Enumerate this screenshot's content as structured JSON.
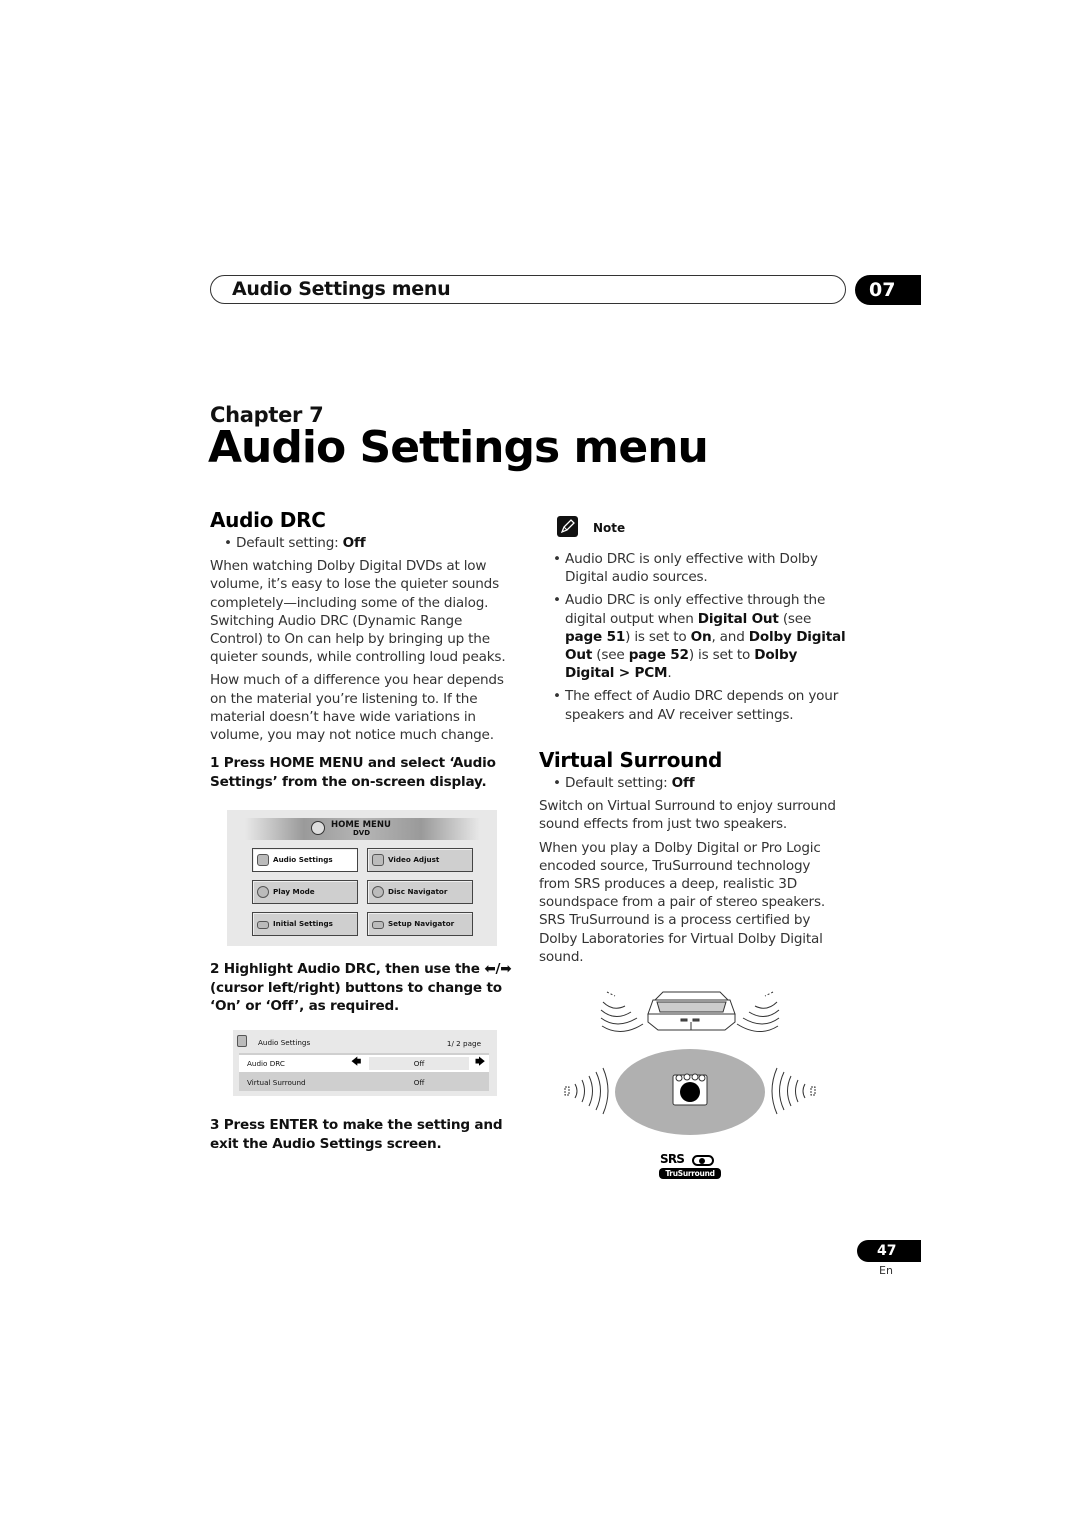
{
  "header": {
    "section_title": "Audio Settings menu",
    "chapter_number": "07"
  },
  "chapter": {
    "label": "Chapter 7",
    "title": "Audio Settings menu"
  },
  "audio_drc": {
    "heading": "Audio DRC",
    "default_label": "Default setting: ",
    "default_value": "Off",
    "paragraphs": [
      "When watching Dolby Digital DVDs at low volume, it’s easy to lose the quieter sounds completely—including some of the dialog. Switching Audio DRC (Dynamic Range Control) to On can help by bringing up the quieter sounds, while controlling loud peaks.",
      "How much of a difference you hear depends on the material you’re listening to. If the material doesn’t have wide variations in volume, you may not notice much change."
    ],
    "steps": [
      "1   Press HOME MENU and select ‘Audio Settings’ from the on-screen display.",
      "2   Highlight Audio DRC, then use the ⬅/➡ (cursor left/right) buttons to change to ‘On’ or ‘Off’, as required.",
      "3   Press ENTER to make the setting and exit the Audio Settings screen."
    ]
  },
  "home_menu_screen": {
    "title": "HOME MENU",
    "subtitle": "DVD",
    "title_icon": "disc-icon",
    "buttons": [
      {
        "label": "Audio Settings",
        "icon": "speaker-icon",
        "selected": true
      },
      {
        "label": "Video Adjust",
        "icon": "monitor-icon",
        "selected": false
      },
      {
        "label": "Play Mode",
        "icon": "play-mode-icon",
        "selected": false
      },
      {
        "label": "Disc Navigator",
        "icon": "disc-navigator-icon",
        "selected": false
      },
      {
        "label": "Initial Settings",
        "icon": "settings-icon",
        "selected": false
      },
      {
        "label": "Setup Navigator",
        "icon": "setup-navigator-icon",
        "selected": false
      }
    ]
  },
  "audio_settings_screen": {
    "title": "Audio Settings",
    "page_indicator": "1/  2 page",
    "rows": [
      {
        "name": "Audio DRC",
        "value": "Off",
        "selected": true
      },
      {
        "name": "Virtual Surround",
        "value": "Off",
        "selected": false
      }
    ],
    "left_arrow": "🡄",
    "right_arrow": "🡆"
  },
  "note": {
    "label": "Note",
    "icon": "pencil-icon",
    "items": [
      "Audio DRC is only effective with Dolby Digital audio sources.",
      "Audio DRC is only effective through the digital output when <b>Digital Out</b> (see <b>page 51</b>) is set to <b>On</b>, and <b>Dolby Digital Out</b> (see <b>page 52</b>) is set to <b>Dolby Digital &gt; PCM</b>.",
      "The effect of Audio DRC depends on your speakers and AV receiver settings."
    ]
  },
  "virtual_surround": {
    "heading": "Virtual Surround",
    "default_label": "Default setting: ",
    "default_value": "Off",
    "paragraphs": [
      "Switch on Virtual Surround to enjoy surround sound effects from just two speakers.",
      "When you play a Dolby Digital or Pro Logic encoded source, TruSurround technology from SRS produces a deep, realistic 3D soundspace from a pair of stereo speakers. SRS TruSurround is a process certified by Dolby Laboratories for Virtual Dolby Digital sound."
    ]
  },
  "srs_logo": {
    "top": "SRS",
    "bottom": "TruSurround"
  },
  "footer": {
    "page_number": "47",
    "language": "En"
  }
}
